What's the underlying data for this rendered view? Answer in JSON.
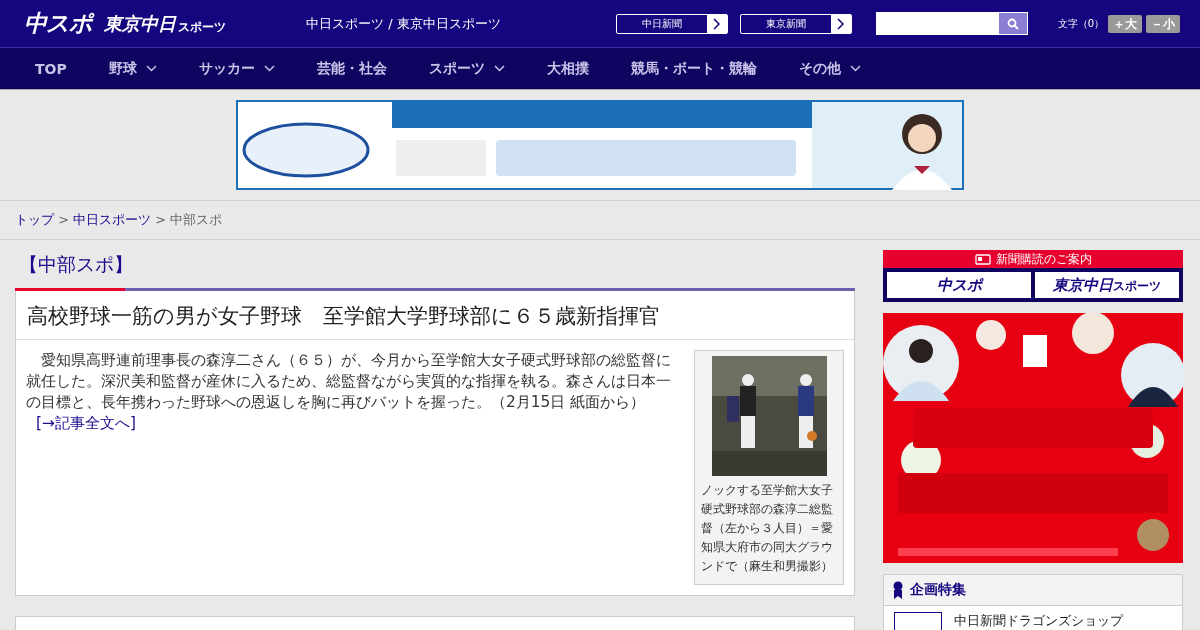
{
  "header": {
    "logo": "中スポ",
    "logo_sub": "東京中日",
    "logo_sub_small": "スポーツ",
    "tagline": "中日スポーツ / 東京中日スポーツ",
    "sites": [
      "中日新聞",
      "東京新聞"
    ],
    "text_size": {
      "label": "文字（0）",
      "buttons": [
        "＋大",
        "－小"
      ]
    }
  },
  "nav": [
    {
      "label": "TOP",
      "dropdown": false
    },
    {
      "label": "野球",
      "dropdown": true
    },
    {
      "label": "サッカー",
      "dropdown": true
    },
    {
      "label": "芸能・社会",
      "dropdown": false
    },
    {
      "label": "スポーツ",
      "dropdown": true
    },
    {
      "label": "大相撲",
      "dropdown": false
    },
    {
      "label": "競馬・ボート・競輪",
      "dropdown": false
    },
    {
      "label": "その他",
      "dropdown": true
    }
  ],
  "breadcrumb": {
    "separator": ">",
    "items": [
      {
        "label": "トップ",
        "link": true
      },
      {
        "label": "中日スポーツ",
        "link": true
      },
      {
        "label": "中部スポ",
        "link": false
      }
    ]
  },
  "article": {
    "section": "【中部スポ】",
    "headline": "高校野球一筋の男が女子野球　至学館大学野球部に６５歳新指揮官",
    "body": "　愛知県高野連前理事長の森淳二さん（６５）が、今月から至学館大女子硬式野球部の総監督に就任した。深沢美和監督が産休に入るため、総監督ながら実質的な指揮を執る。森さんは日本一の目標と、長年携わった野球への恩返しを胸に再びバットを握った。（2月15日 紙面から）",
    "more_link": "[→記事全文へ]",
    "photo_caption": "ノックする至学館大女子硬式野球部の森淳二総監督（左から３人目）＝愛知県大府市の同大グラウンドで（麻生和男撮影）"
  },
  "sidebar": {
    "subscribe": {
      "title": "新聞購読のご案内",
      "papers": [
        {
          "logo": "中スポ"
        },
        {
          "logo": "東京中日",
          "small": "スポーツ"
        }
      ]
    },
    "feature": {
      "title": "企画特集",
      "items": [
        "中日新聞ドラゴンズショップ"
      ]
    }
  }
}
